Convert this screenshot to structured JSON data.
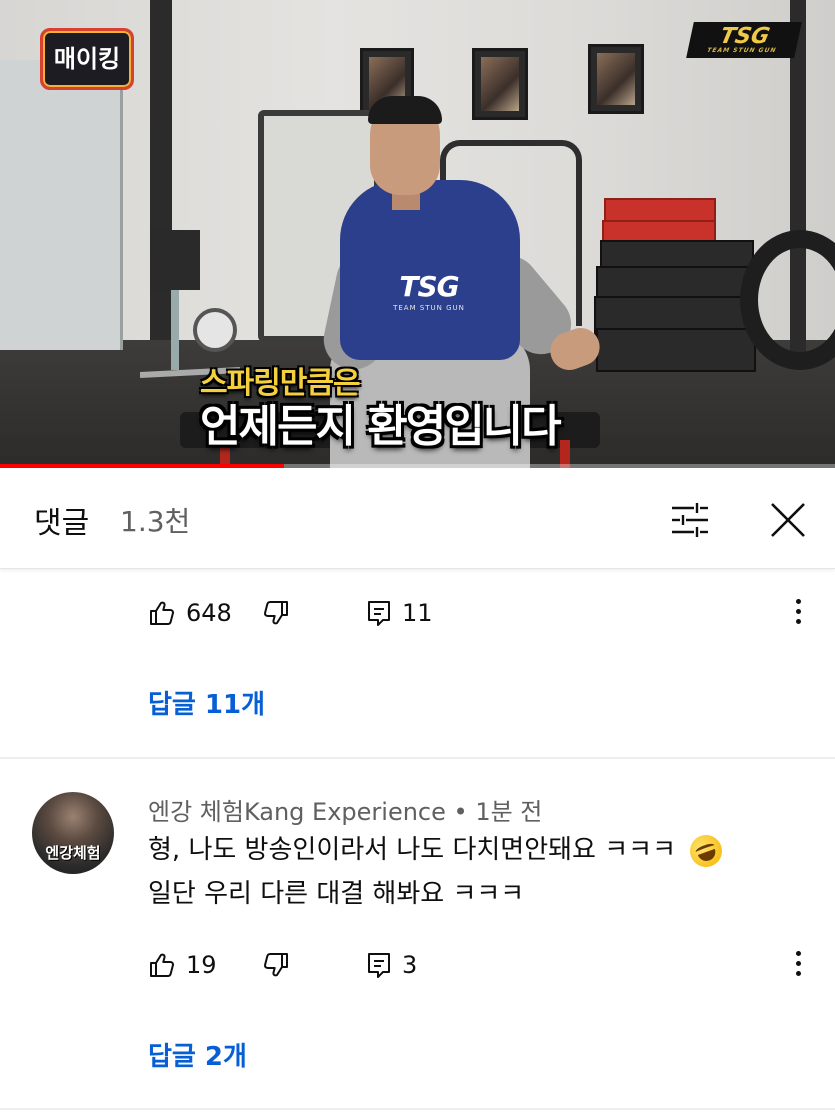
{
  "video": {
    "channel_logo_text": "매이킹",
    "brand_logo_text": "TSG",
    "brand_logo_sub": "TEAM STUN GUN",
    "shirt_logo_text": "TSG",
    "shirt_logo_sub": "TEAM STUN GUN",
    "subtitle_line1": "스파링만큼은",
    "subtitle_line2": "언제든지 환영입니다",
    "progress": 0.34,
    "progress_color": "#ff0000"
  },
  "comments_header": {
    "title": "댓글",
    "count": "1.3천",
    "filter_icon": "filter-sliders-icon",
    "close_icon": "close-icon"
  },
  "comment1": {
    "likes": "648",
    "reply_count": "11",
    "replies_link": "답글 11개"
  },
  "comment2": {
    "avatar_text": "엔강체험",
    "author": "엔강 체험Kang Experience",
    "time": "1분 전",
    "text_line1": "형, 나도 방송인이라서 나도 다치면안돼요 ㅋㅋㅋ",
    "emoji": "rolling-on-floor-laughing-emoji",
    "text_line2": "일단 우리 다른 대결 해봐요 ㅋㅋㅋ",
    "likes": "19",
    "reply_count": "3",
    "replies_link": "답글 2개"
  },
  "colors": {
    "link_blue": "#065fd4",
    "secondary_text": "#606060"
  }
}
